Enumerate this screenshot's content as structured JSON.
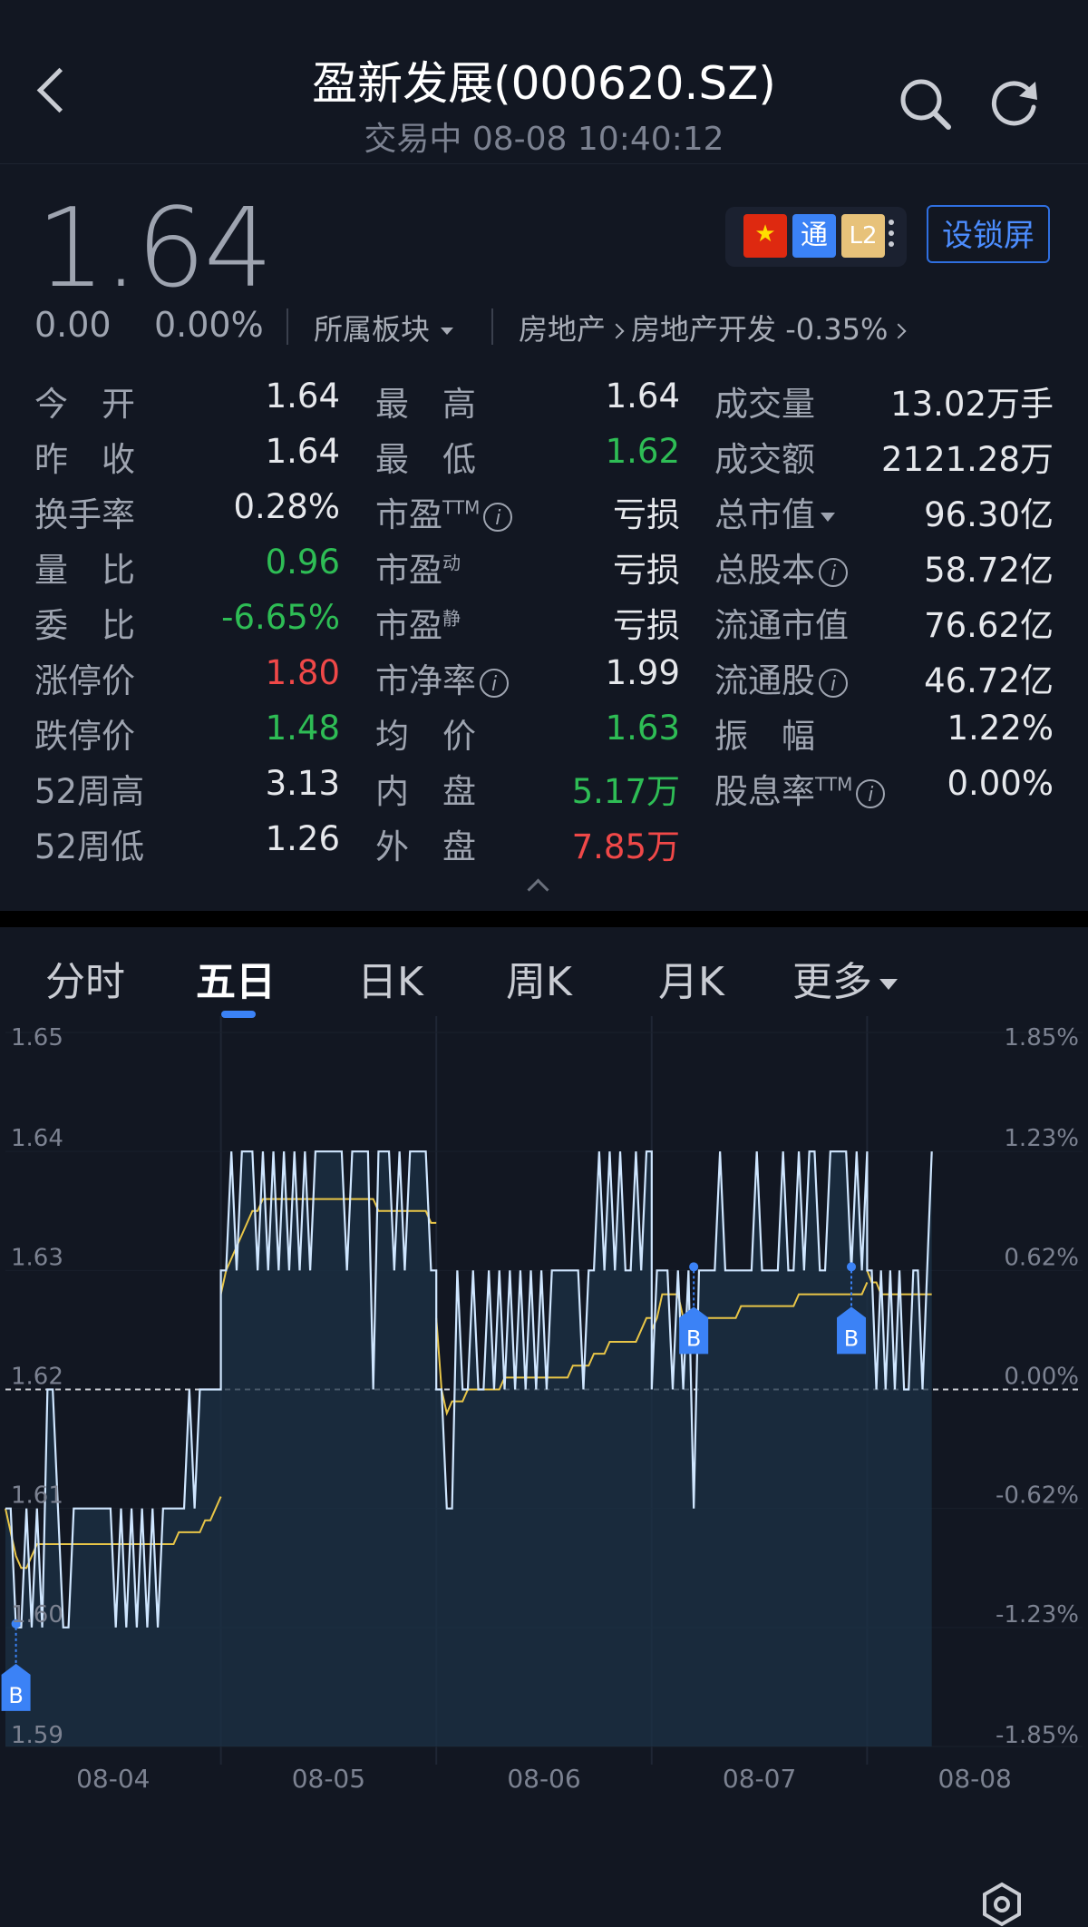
{
  "header": {
    "title": "盈新发展(000620.SZ)",
    "subtitle": "交易中 08-08 10:40:12"
  },
  "quote": {
    "price": "1.64",
    "change": "0.00",
    "change_pct": "0.00%",
    "sector_label": "所属板块",
    "industry_l1": "房地产",
    "industry_l2": "房地产开发",
    "industry_chg": "-0.35%",
    "lock_button": "设锁屏",
    "badges": {
      "flag": "★",
      "tong": "通",
      "l2": "L2"
    }
  },
  "stats": {
    "col1": [
      {
        "label": "今　开",
        "value": "1.64",
        "color": "#e6e8ec"
      },
      {
        "label": "昨　收",
        "value": "1.64",
        "color": "#e6e8ec"
      },
      {
        "label": "换手率",
        "value": "0.28%",
        "color": "#e6e8ec"
      },
      {
        "label": "量　比",
        "value": "0.96",
        "color": "#2ebd55"
      },
      {
        "label": "委　比",
        "value": "-6.65%",
        "color": "#2ebd55"
      },
      {
        "label": "涨停价",
        "value": "1.80",
        "color": "#f04848"
      },
      {
        "label": "跌停价",
        "value": "1.48",
        "color": "#2ebd55"
      },
      {
        "label": "52周高",
        "value": "3.13",
        "color": "#e6e8ec"
      },
      {
        "label": "52周低",
        "value": "1.26",
        "color": "#e6e8ec"
      }
    ],
    "col2": [
      {
        "label": "最　高",
        "value": "1.64",
        "color": "#e6e8ec"
      },
      {
        "label": "最　低",
        "value": "1.62",
        "color": "#2ebd55"
      },
      {
        "label": "市盈",
        "sup": "TTM",
        "info": true,
        "value": "亏损",
        "color": "#e6e8ec"
      },
      {
        "label": "市盈",
        "sup": "动",
        "value": "亏损",
        "color": "#e6e8ec"
      },
      {
        "label": "市盈",
        "sup": "静",
        "value": "亏损",
        "color": "#e6e8ec"
      },
      {
        "label": "市净率",
        "info": true,
        "value": "1.99",
        "color": "#e6e8ec"
      },
      {
        "label": "均　价",
        "value": "1.63",
        "color": "#2ebd55"
      },
      {
        "label": "内　盘",
        "value": "5.17万",
        "color": "#2ebd55"
      },
      {
        "label": "外　盘",
        "value": "7.85万",
        "color": "#f04848"
      }
    ],
    "col3": [
      {
        "label": "成交量",
        "value": "13.02万手",
        "color": "#e6e8ec"
      },
      {
        "label": "成交额",
        "value": "2121.28万",
        "color": "#e6e8ec"
      },
      {
        "label": "总市值",
        "dropdown": true,
        "value": "96.30亿",
        "color": "#e6e8ec"
      },
      {
        "label": "总股本",
        "info": true,
        "value": "58.72亿",
        "color": "#e6e8ec"
      },
      {
        "label": "流通市值",
        "value": "76.62亿",
        "color": "#e6e8ec"
      },
      {
        "label": "流通股",
        "info": true,
        "value": "46.72亿",
        "color": "#e6e8ec"
      },
      {
        "label": "振　幅",
        "value": "1.22%",
        "color": "#e6e8ec"
      },
      {
        "label": "股息率",
        "sup": "TTM",
        "info": true,
        "value": "0.00%",
        "color": "#e6e8ec"
      }
    ]
  },
  "tabs": [
    {
      "label": "分时",
      "active": false
    },
    {
      "label": "五日",
      "active": true
    },
    {
      "label": "日K",
      "active": false
    },
    {
      "label": "周K",
      "active": false
    },
    {
      "label": "月K",
      "active": false
    },
    {
      "label": "更多",
      "active": false,
      "dropdown": true
    }
  ],
  "colors": {
    "background": "#121722",
    "price_line": "#cfe6ff",
    "avg_line": "#e8c547",
    "fill": "#1c3146",
    "marker": "#3b82f6",
    "up": "#f04848",
    "down": "#2ebd55"
  },
  "icons": [
    "back-chevron-icon",
    "search-icon",
    "refresh-icon",
    "china-flag-icon",
    "settings-hex-icon"
  ],
  "chart_data": {
    "type": "line",
    "days": [
      "08-04",
      "08-05",
      "08-06",
      "08-07",
      "08-08"
    ],
    "y_ticks_left": [
      "1.65",
      "1.64",
      "1.63",
      "1.62",
      "1.61",
      "1.60",
      "1.59"
    ],
    "y_ticks_right": [
      "1.85%",
      "1.23%",
      "0.62%",
      "0.00%",
      "-0.62%",
      "-1.23%",
      "-1.85%"
    ],
    "ylim": [
      1.59,
      1.65
    ],
    "prev_close": 1.62,
    "marker_label": "B",
    "buy_markers": [
      {
        "day": 0,
        "pos": 0.05,
        "price": 1.6
      },
      {
        "day": 3,
        "pos": 0.2,
        "price": 1.63
      },
      {
        "day": 3,
        "pos": 0.92,
        "price": 1.63
      }
    ],
    "series": [
      {
        "day": "08-04",
        "price": [
          1.61,
          1.61,
          1.6,
          1.6,
          1.61,
          1.6,
          1.61,
          1.6,
          1.62,
          1.62,
          1.61,
          1.6,
          1.6,
          1.61,
          1.61,
          1.61,
          1.61,
          1.61,
          1.61,
          1.61,
          1.61,
          1.6,
          1.61,
          1.6,
          1.61,
          1.6,
          1.61,
          1.6,
          1.61,
          1.6,
          1.61,
          1.61,
          1.61,
          1.61,
          1.61,
          1.62,
          1.61,
          1.62,
          1.62,
          1.62,
          1.62,
          1.62
        ],
        "avg": [
          1.61,
          1.608,
          1.606,
          1.605,
          1.605,
          1.606,
          1.607,
          1.607,
          1.607,
          1.607,
          1.607,
          1.607,
          1.607,
          1.607,
          1.607,
          1.607,
          1.607,
          1.607,
          1.607,
          1.607,
          1.607,
          1.607,
          1.607,
          1.607,
          1.607,
          1.607,
          1.607,
          1.607,
          1.607,
          1.607,
          1.607,
          1.607,
          1.607,
          1.608,
          1.608,
          1.608,
          1.608,
          1.608,
          1.609,
          1.609,
          1.61,
          1.611
        ]
      },
      {
        "day": "08-05",
        "price": [
          1.63,
          1.63,
          1.64,
          1.63,
          1.64,
          1.64,
          1.64,
          1.63,
          1.64,
          1.63,
          1.64,
          1.63,
          1.64,
          1.63,
          1.64,
          1.63,
          1.64,
          1.63,
          1.64,
          1.64,
          1.64,
          1.64,
          1.64,
          1.64,
          1.63,
          1.64,
          1.64,
          1.64,
          1.64,
          1.62,
          1.64,
          1.64,
          1.64,
          1.63,
          1.64,
          1.63,
          1.64,
          1.64,
          1.64,
          1.64,
          1.63,
          1.63
        ],
        "avg": [
          1.628,
          1.63,
          1.631,
          1.632,
          1.633,
          1.634,
          1.635,
          1.635,
          1.636,
          1.636,
          1.636,
          1.636,
          1.636,
          1.636,
          1.636,
          1.636,
          1.636,
          1.636,
          1.636,
          1.636,
          1.636,
          1.636,
          1.636,
          1.636,
          1.636,
          1.636,
          1.636,
          1.636,
          1.636,
          1.636,
          1.635,
          1.635,
          1.635,
          1.635,
          1.635,
          1.635,
          1.635,
          1.635,
          1.635,
          1.635,
          1.634,
          1.634
        ]
      },
      {
        "day": "08-06",
        "price": [
          1.62,
          1.62,
          1.61,
          1.61,
          1.63,
          1.62,
          1.62,
          1.63,
          1.62,
          1.62,
          1.63,
          1.62,
          1.63,
          1.62,
          1.63,
          1.62,
          1.63,
          1.62,
          1.63,
          1.62,
          1.63,
          1.62,
          1.63,
          1.63,
          1.63,
          1.63,
          1.63,
          1.63,
          1.62,
          1.63,
          1.63,
          1.64,
          1.63,
          1.64,
          1.63,
          1.64,
          1.63,
          1.63,
          1.64,
          1.63,
          1.64,
          1.64
        ],
        "avg": [
          1.626,
          1.62,
          1.618,
          1.619,
          1.619,
          1.619,
          1.62,
          1.62,
          1.62,
          1.62,
          1.62,
          1.62,
          1.62,
          1.621,
          1.621,
          1.621,
          1.621,
          1.621,
          1.621,
          1.621,
          1.621,
          1.621,
          1.621,
          1.621,
          1.621,
          1.621,
          1.622,
          1.622,
          1.622,
          1.622,
          1.623,
          1.623,
          1.623,
          1.624,
          1.624,
          1.624,
          1.624,
          1.624,
          1.624,
          1.625,
          1.626,
          1.626
        ]
      },
      {
        "day": "08-07",
        "price": [
          1.62,
          1.63,
          1.63,
          1.63,
          1.62,
          1.63,
          1.62,
          1.63,
          1.61,
          1.63,
          1.63,
          1.63,
          1.63,
          1.64,
          1.63,
          1.63,
          1.63,
          1.63,
          1.63,
          1.63,
          1.64,
          1.63,
          1.63,
          1.63,
          1.63,
          1.64,
          1.63,
          1.63,
          1.64,
          1.63,
          1.64,
          1.64,
          1.63,
          1.63,
          1.64,
          1.64,
          1.64,
          1.64,
          1.63,
          1.64,
          1.63,
          1.64
        ],
        "avg": [
          1.625,
          1.626,
          1.628,
          1.628,
          1.628,
          1.628,
          1.626,
          1.626,
          1.626,
          1.626,
          1.626,
          1.626,
          1.626,
          1.626,
          1.626,
          1.626,
          1.626,
          1.627,
          1.627,
          1.627,
          1.627,
          1.627,
          1.627,
          1.627,
          1.627,
          1.627,
          1.627,
          1.627,
          1.628,
          1.628,
          1.628,
          1.628,
          1.628,
          1.628,
          1.628,
          1.628,
          1.628,
          1.628,
          1.628,
          1.628,
          1.628,
          1.629
        ]
      },
      {
        "day": "08-08",
        "price": [
          1.63,
          1.63,
          1.62,
          1.63,
          1.62,
          1.63,
          1.62,
          1.63,
          1.62,
          1.62,
          1.63,
          1.63,
          1.62,
          1.63,
          1.64
        ],
        "avg": [
          1.63,
          1.629,
          1.629,
          1.628,
          1.628,
          1.628,
          1.628,
          1.628,
          1.628,
          1.628,
          1.628,
          1.628,
          1.628,
          1.628,
          1.628
        ]
      }
    ]
  }
}
